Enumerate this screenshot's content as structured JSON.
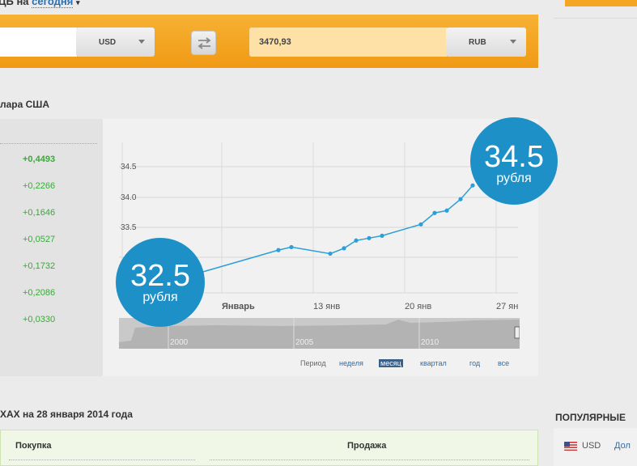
{
  "header": {
    "title_prefix": "ЦБ на",
    "title_link": "сегодня",
    "caret": "▾"
  },
  "converter": {
    "from_value": "",
    "from_currency": "USD",
    "to_value": "3470,93",
    "to_currency": "RUB"
  },
  "section": {
    "title": "лара США"
  },
  "changes": [
    "+0,4493",
    "+0,2266",
    "+0,1646",
    "+0,0527",
    "+0,1732",
    "+0,2086",
    "+0,0330"
  ],
  "chart_data": {
    "type": "line",
    "y_ticks": [
      "34.5",
      "34.0",
      "33.5"
    ],
    "x_ticks": [
      "Январь",
      "13 янв",
      "20 янв",
      "27 ян"
    ],
    "ylim": [
      32.5,
      34.7
    ],
    "series": [
      {
        "x": [
          0,
          6,
          7,
          9,
          10,
          11,
          12,
          13,
          15,
          16,
          17,
          18,
          19
        ],
        "values": [
          32.75,
          33.12,
          33.17,
          33.06,
          33.15,
          33.28,
          33.32,
          33.36,
          33.55,
          33.74,
          33.78,
          33.97,
          34.2
        ]
      }
    ],
    "line_color": "#2c9fd8",
    "navigator_years": [
      "2000",
      "2005",
      "2010"
    ]
  },
  "bubbles": {
    "left": {
      "value": "32.5",
      "unit": "рубля"
    },
    "right": {
      "value": "34.5",
      "unit": "рубля"
    }
  },
  "period": {
    "label": "Период",
    "options": [
      "неделя",
      "месяц",
      "квартал",
      "год",
      "все"
    ],
    "active": "месяц"
  },
  "rates": {
    "title": "ХАХ на 28 января 2014 года",
    "buy": "Покупка",
    "sell": "Продажа"
  },
  "popular": {
    "title": "ПОПУЛЯРНЫЕ",
    "code": "USD",
    "link": "Дол"
  },
  "colors": {
    "accent": "#f5a623",
    "bubble": "#1d91c7",
    "positive": "#3aa83a"
  }
}
